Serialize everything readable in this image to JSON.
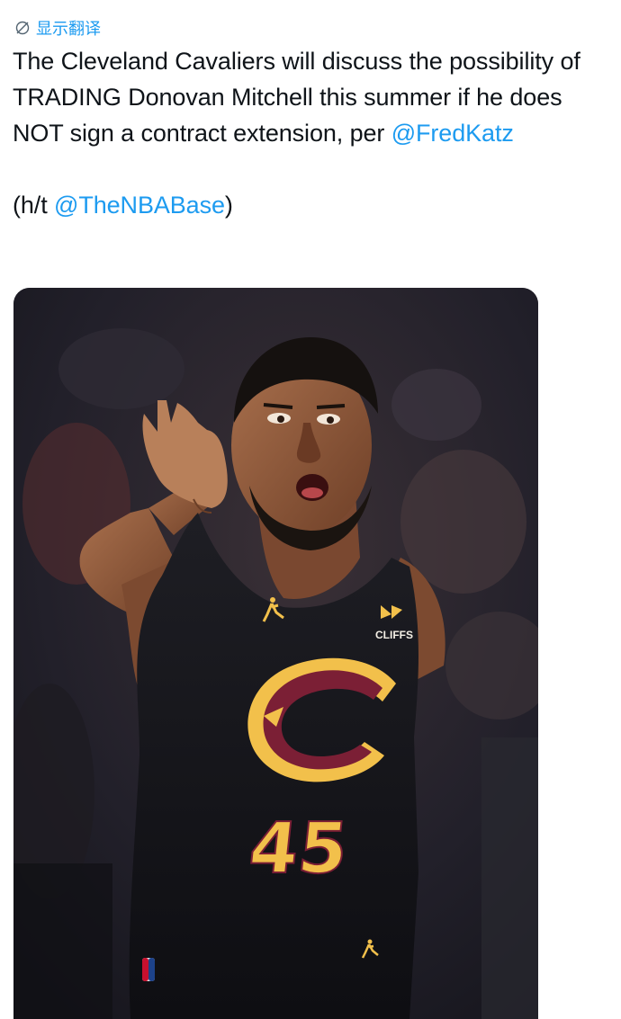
{
  "translate": {
    "label": "显示翻译",
    "icon": "globe-translate-icon",
    "color": "#1d9bf0"
  },
  "tweet": {
    "line1": "The Cleveland Cavaliers will discuss the possibility of TRADING Donovan Mitchell this summer if he does NOT sign a contract extension, per ",
    "mention1": "@FredKatz",
    "line2_prefix": "(h/t ",
    "mention2": "@TheNBABase",
    "line2_suffix": ")"
  },
  "media": {
    "jersey_number": "45",
    "sponsor": "CLIFFS",
    "team_letter": "C",
    "colors": {
      "wine": "#7b1f35",
      "gold": "#f2c04b",
      "jersey": "#16161a"
    }
  }
}
